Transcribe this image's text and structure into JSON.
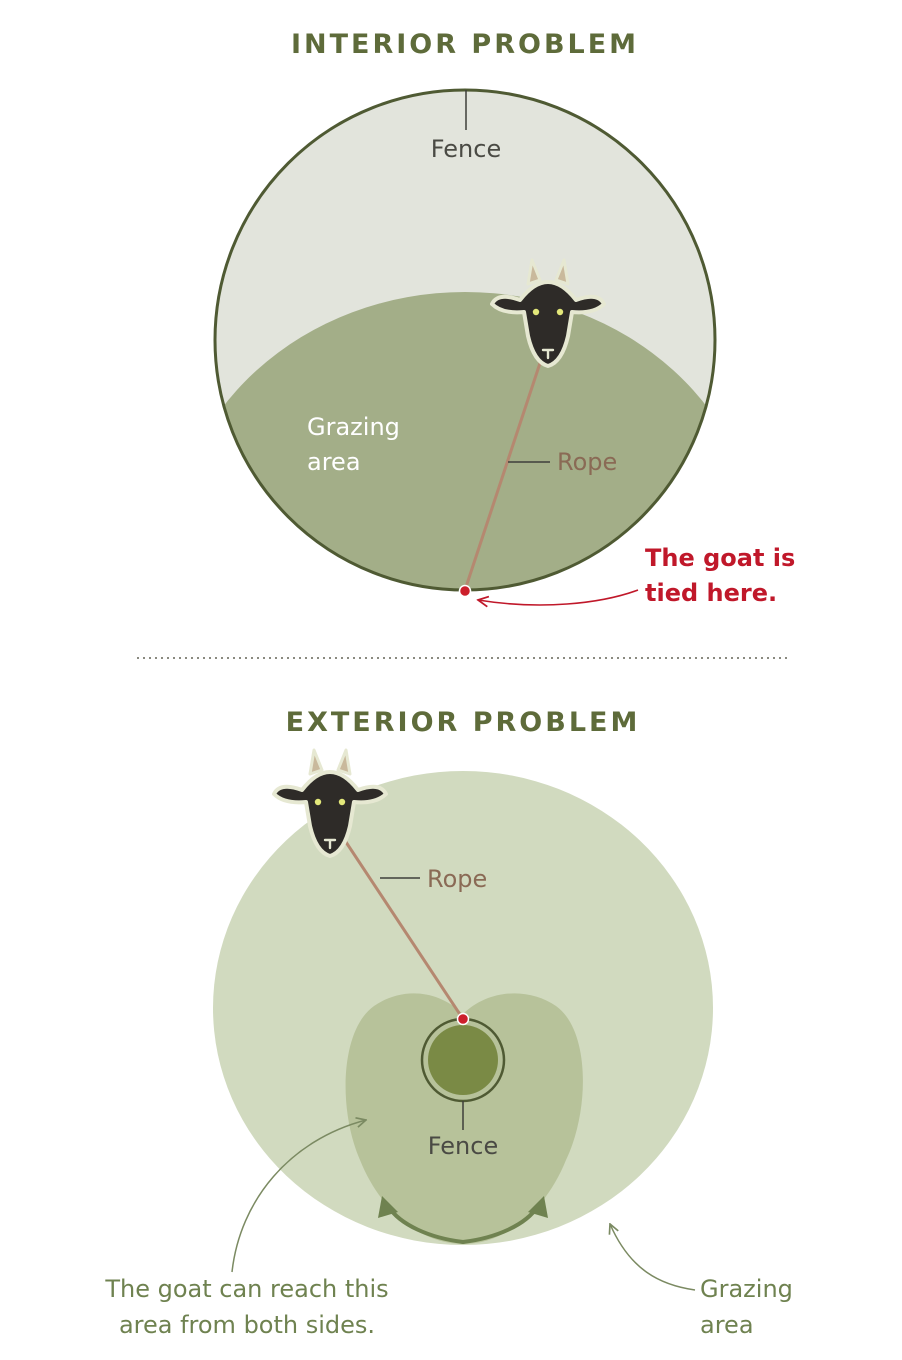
{
  "interior": {
    "title": "INTERIOR PROBLEM",
    "fence_label": "Fence",
    "grazing_label_line1": "Grazing",
    "grazing_label_line2": "area",
    "rope_label": "Rope",
    "tied_label_line1": "The goat is",
    "tied_label_line2": "tied here."
  },
  "exterior": {
    "title": "EXTERIOR PROBLEM",
    "rope_label": "Rope",
    "fence_label": "Fence",
    "both_sides_line1": "The goat can reach this",
    "both_sides_line2": "area from both sides.",
    "grazing_label_line1": "Grazing",
    "grazing_label_line2": "area"
  },
  "colors": {
    "title": "#5e6b3a",
    "fence_fill": "#e2e4dc",
    "fence_stroke": "#4f5a33",
    "grazing_dark": "#a3ae88",
    "grazing_light": "#d1dabf",
    "overlap": "#b7c29a",
    "fence_core": "#7a8a45",
    "rope": "#b58870",
    "rope_label": "#8a6a55",
    "tie_point": "#cc1f2b",
    "tie_label": "#c0182a",
    "note_text": "#6f8250",
    "goat_face": "#2e2b28",
    "goat_outline": "#e6e8d2"
  }
}
